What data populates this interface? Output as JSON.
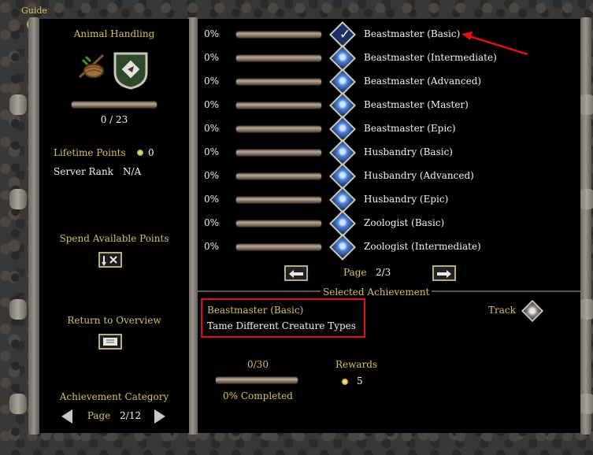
{
  "guide": {
    "label": "Guide"
  },
  "left": {
    "skill_title": "Animal Handling",
    "progress": {
      "count": "0 / 23",
      "fraction": 0
    },
    "lifetime_points_label": "Lifetime Points",
    "lifetime_points_value": "0",
    "server_rank_label": "Server Rank",
    "server_rank_value": "N/A",
    "spend_label": "Spend Available Points",
    "return_label": "Return to Overview",
    "category_label": "Achievement Category",
    "page_label": "Page",
    "page_value": "2/12"
  },
  "achievements": [
    {
      "pct": "0%",
      "name": "Beastmaster (Basic)",
      "selected": true
    },
    {
      "pct": "0%",
      "name": "Beastmaster (Intermediate)",
      "selected": false
    },
    {
      "pct": "0%",
      "name": "Beastmaster (Advanced)",
      "selected": false
    },
    {
      "pct": "0%",
      "name": "Beastmaster (Master)",
      "selected": false
    },
    {
      "pct": "0%",
      "name": "Beastmaster (Epic)",
      "selected": false
    },
    {
      "pct": "0%",
      "name": "Husbandry (Basic)",
      "selected": false
    },
    {
      "pct": "0%",
      "name": "Husbandry (Advanced)",
      "selected": false
    },
    {
      "pct": "0%",
      "name": "Husbandry (Epic)",
      "selected": false
    },
    {
      "pct": "0%",
      "name": "Zoologist (Basic)",
      "selected": false
    },
    {
      "pct": "0%",
      "name": "Zoologist (Intermediate)",
      "selected": false
    }
  ],
  "list_page": {
    "label": "Page",
    "value": "2/3"
  },
  "selected": {
    "section_title": "Selected Achievement",
    "name": "Beastmaster (Basic)",
    "description": "Tame Different Creature Types",
    "track_label": "Track",
    "progress_count": "0/30",
    "progress_fraction": 0,
    "completed_label": "0% Completed",
    "rewards_label": "Rewards",
    "rewards_value": "5"
  },
  "colors": {
    "accent_gold": "#d8c060",
    "highlight_red": "#e0101a"
  }
}
